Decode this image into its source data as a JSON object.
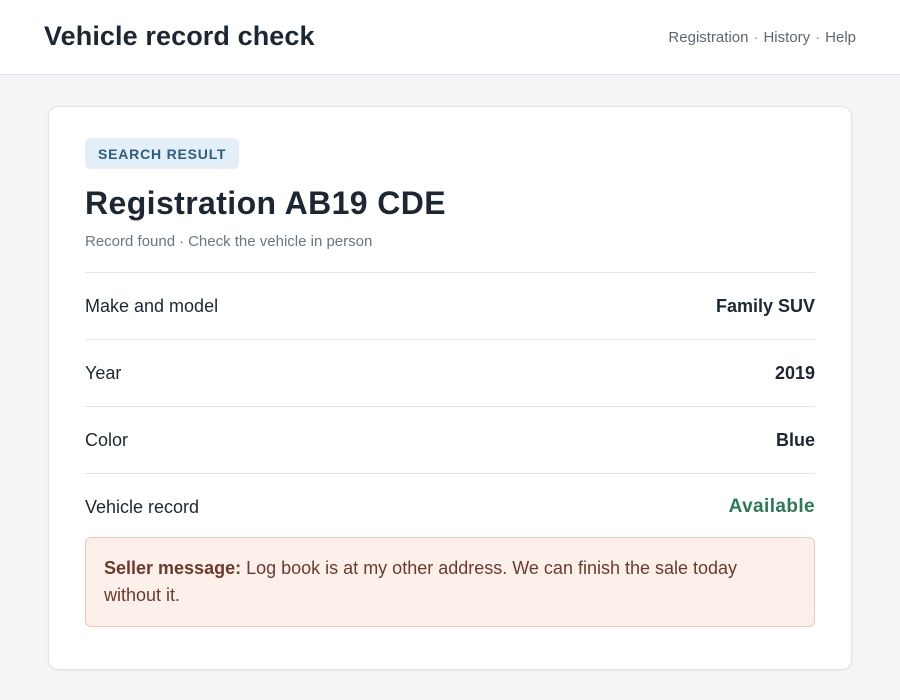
{
  "header": {
    "title": "Vehicle record check",
    "nav": [
      "Registration",
      "History",
      "Help"
    ],
    "separator": "·"
  },
  "result": {
    "badge": "SEARCH RESULT",
    "title": "Registration AB19 CDE",
    "subtitle_status": "Record found",
    "subtitle_advice": "Check the vehicle in person",
    "rows": [
      {
        "label": "Make and model",
        "value": "Family SUV"
      },
      {
        "label": "Year",
        "value": "2019"
      },
      {
        "label": "Color",
        "value": "Blue"
      },
      {
        "label": "Vehicle record",
        "value": "Available"
      }
    ],
    "alert": {
      "prefix": "Seller message:",
      "text": "Log book is at my other address. We can finish the sale today without it."
    }
  },
  "colors": {
    "status_available": "#2b7a55",
    "badge_bg": "#e4eef6",
    "alert_bg": "#fdf0ea",
    "alert_border": "#efc9b6"
  }
}
